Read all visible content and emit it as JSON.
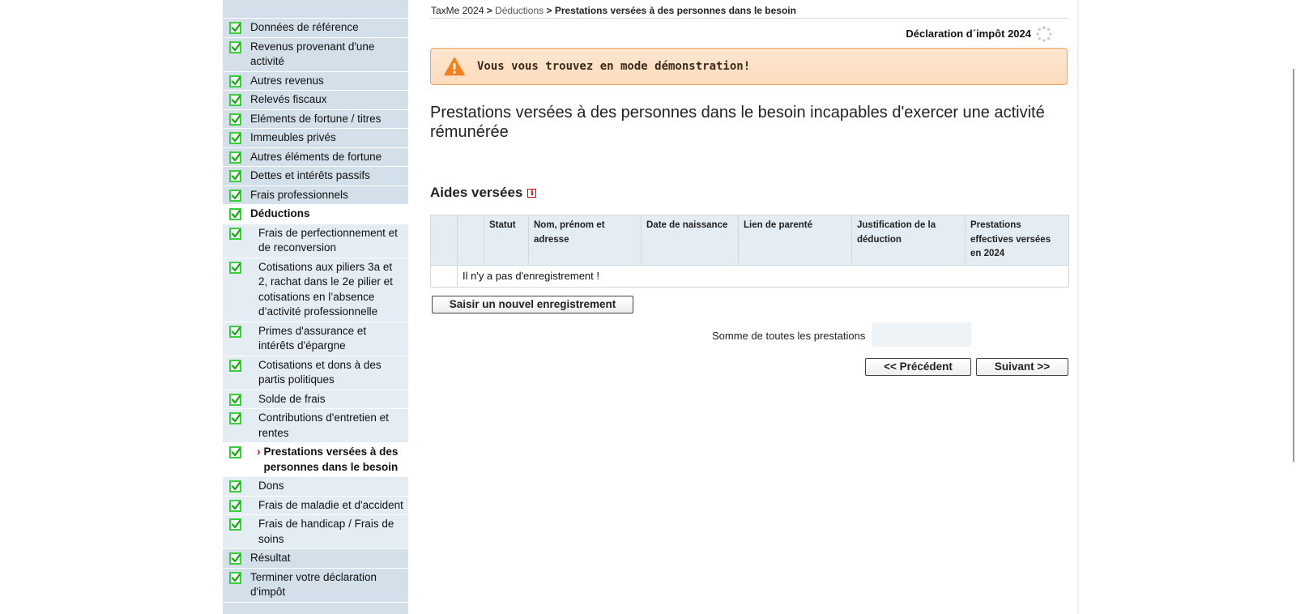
{
  "sidebar": {
    "items": [
      {
        "label": "Données de référence",
        "level": 1,
        "state": "done"
      },
      {
        "label": "Revenus provenant d'une activité",
        "level": 1,
        "state": "done"
      },
      {
        "label": "Autres revenus",
        "level": 1,
        "state": "done"
      },
      {
        "label": "Relevés fiscaux",
        "level": 1,
        "state": "done"
      },
      {
        "label": "Eléments de fortune / titres",
        "level": 1,
        "state": "done"
      },
      {
        "label": "Immeubles privés",
        "level": 1,
        "state": "done"
      },
      {
        "label": "Autres éléments de fortune",
        "level": 1,
        "state": "done"
      },
      {
        "label": "Dettes et intérêts passifs",
        "level": 1,
        "state": "done"
      },
      {
        "label": "Frais professionnels",
        "level": 1,
        "state": "done"
      },
      {
        "label": "Déductions",
        "level": 1,
        "state": "active"
      },
      {
        "label": "Frais de perfectionnement et de reconversion",
        "level": 2,
        "state": "done"
      },
      {
        "label": "Cotisations aux piliers 3a et 2, rachat dans le 2e pilier et cotisations en l’absence d’activité professionnelle",
        "level": 2,
        "state": "done"
      },
      {
        "label": "Primes d'assurance et intérêts d'épargne",
        "level": 2,
        "state": "done"
      },
      {
        "label": "Cotisations et dons à des partis politiques",
        "level": 2,
        "state": "done"
      },
      {
        "label": "Solde de frais",
        "level": 2,
        "state": "done"
      },
      {
        "label": "Contributions d'entretien et rentes",
        "level": 2,
        "state": "done"
      },
      {
        "label": "Prestations versées à des personnes dans le besoin",
        "level": 2,
        "state": "current"
      },
      {
        "label": "Dons",
        "level": 2,
        "state": "done"
      },
      {
        "label": "Frais de maladie et d'accident",
        "level": 2,
        "state": "done"
      },
      {
        "label": "Frais de handicap / Frais de soins",
        "level": 2,
        "state": "done"
      },
      {
        "label": "Résultat",
        "level": 1,
        "state": "done"
      },
      {
        "label": "Terminer votre déclaration d'impôt",
        "level": 1,
        "state": "done"
      }
    ]
  },
  "breadcrumb": {
    "root": "TaxMe 2024",
    "sep": ">",
    "section": "Déductions",
    "current": "Prestations versées à des personnes dans le besoin"
  },
  "header": {
    "declaration_title": "Déclaration d´impôt 2024"
  },
  "banner": {
    "text": "Vous vous trouvez en mode démonstration!",
    "color": "#f77f1a"
  },
  "page": {
    "title": "Prestations versées à des personnes dans le besoin incapables d'exercer une activité rémunérée",
    "section_title": "Aides versées"
  },
  "table": {
    "columns": [
      "",
      "",
      "Statut",
      "Nom, prénom et adresse",
      "Date de naissance",
      "Lien de parenté",
      "Justification de la déduction",
      "Prestations effectives versées en 2024"
    ],
    "empty_message": "Il n'y a pas d'enregistrement !"
  },
  "actions": {
    "new_record": "Saisir un nouvel enregistrement",
    "sum_label": "Somme de toutes les prestations",
    "sum_value": "",
    "previous": "<< Précédent",
    "next": "Suivant >>"
  }
}
